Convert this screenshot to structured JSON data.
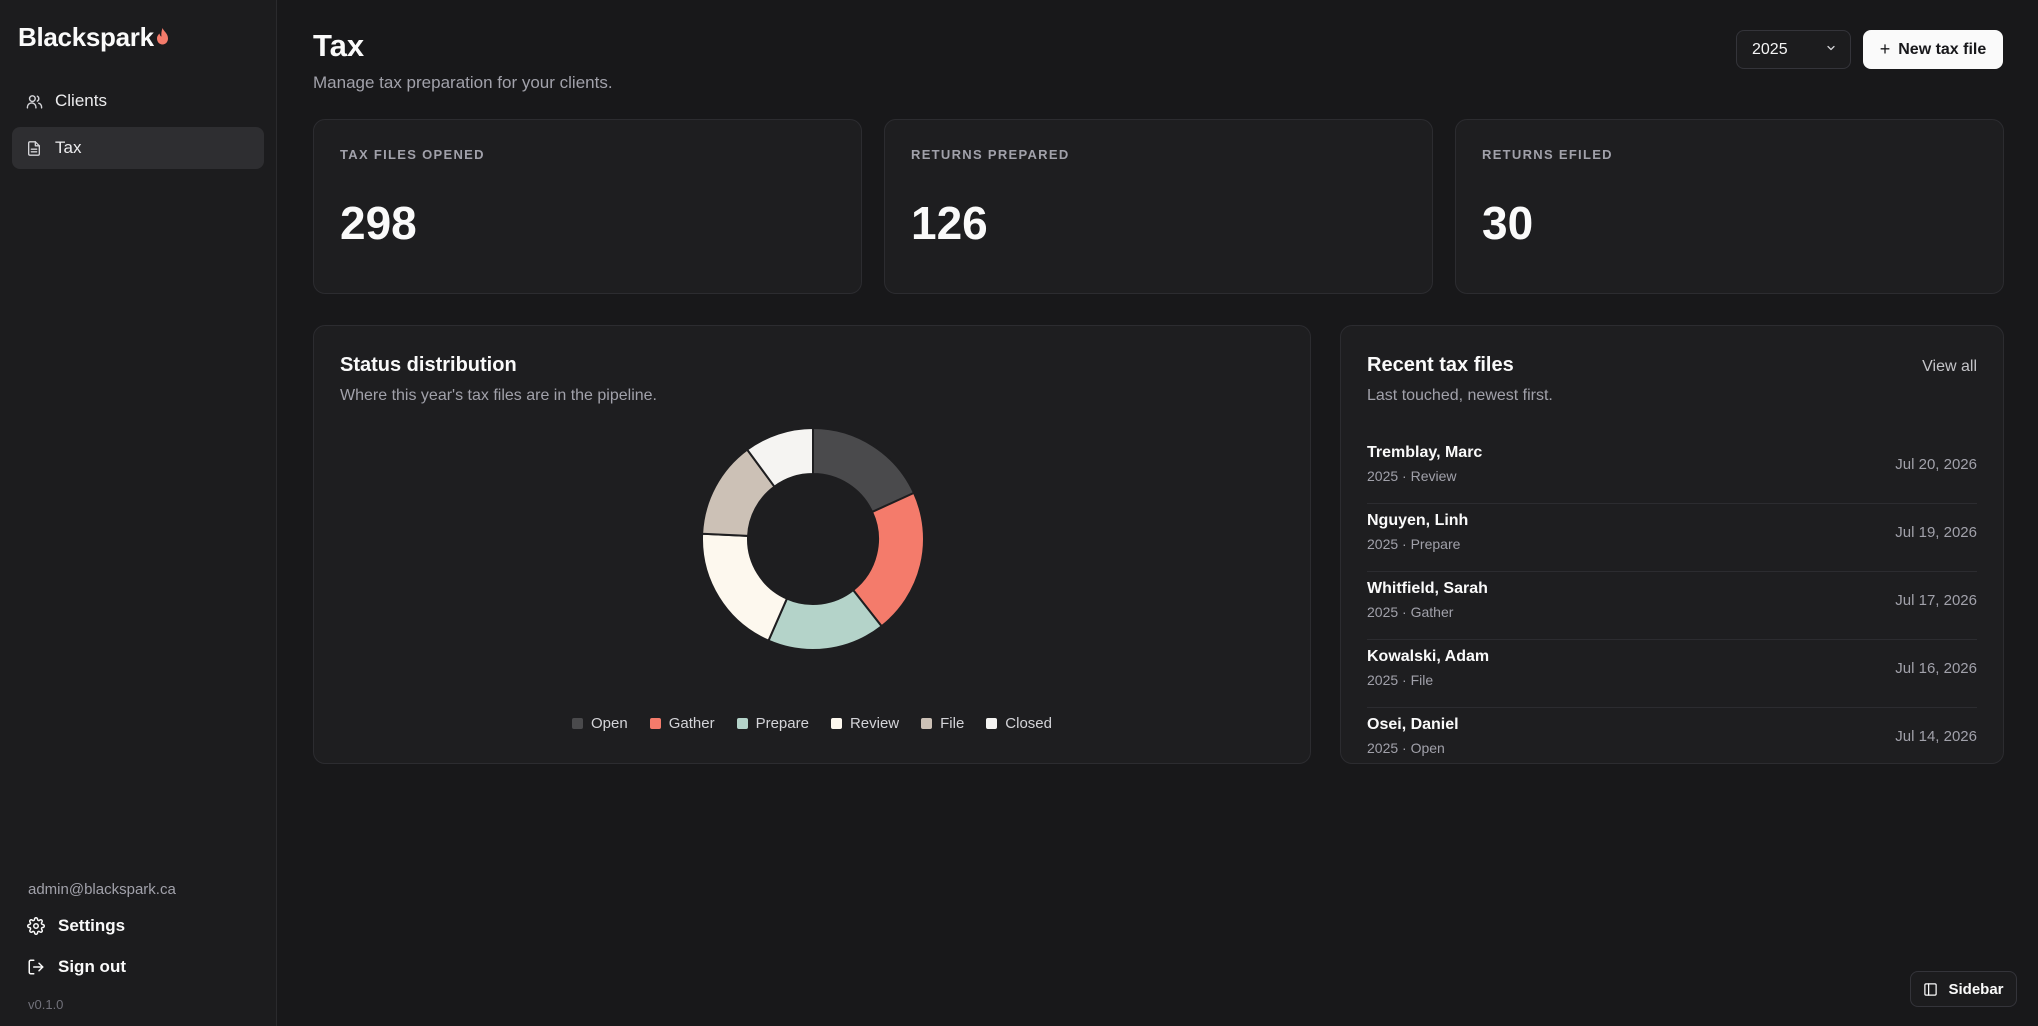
{
  "app": {
    "brand": "Blackspark"
  },
  "sidebar": {
    "items": [
      {
        "label": "Clients",
        "icon": "users-icon"
      },
      {
        "label": "Tax",
        "icon": "file-icon",
        "active": true
      }
    ],
    "user_email": "admin@blackspark.ca",
    "settings_label": "Settings",
    "signout_label": "Sign out",
    "version": "v0.1.0"
  },
  "header": {
    "title": "Tax",
    "subtitle": "Manage tax preparation for your clients.",
    "year_selected": "2025",
    "new_button_label": "New tax file"
  },
  "stats": [
    {
      "label": "TAX FILES OPENED",
      "value": "298"
    },
    {
      "label": "RETURNS PREPARED",
      "value": "126"
    },
    {
      "label": "RETURNS EFILED",
      "value": "30"
    }
  ],
  "status_panel": {
    "title": "Status distribution",
    "subtitle": "Where this year's tax files are in the pipeline."
  },
  "chart_data": {
    "type": "pie",
    "donut": true,
    "legend_position": "bottom",
    "series": [
      {
        "name": "Open",
        "value": 18,
        "color": "#4a4a4c"
      },
      {
        "name": "Gather",
        "value": 21,
        "color": "#f47b6b"
      },
      {
        "name": "Prepare",
        "value": 17,
        "color": "#b4d3c9"
      },
      {
        "name": "Review",
        "value": 19,
        "color": "#fdf8ee"
      },
      {
        "name": "File",
        "value": 14,
        "color": "#ccc1b6"
      },
      {
        "name": "Closed",
        "value": 10,
        "color": "#f5f4f2"
      }
    ]
  },
  "recent_panel": {
    "title": "Recent tax files",
    "subtitle": "Last touched, newest first.",
    "view_all_label": "View all",
    "items": [
      {
        "name": "Tremblay, Marc",
        "meta": "2025 · Review",
        "date": "Jul 20, 2026"
      },
      {
        "name": "Nguyen, Linh",
        "meta": "2025 · Prepare",
        "date": "Jul 19, 2026"
      },
      {
        "name": "Whitfield, Sarah",
        "meta": "2025 · Gather",
        "date": "Jul 17, 2026"
      },
      {
        "name": "Kowalski, Adam",
        "meta": "2025 · File",
        "date": "Jul 16, 2026"
      },
      {
        "name": "Osei, Daniel",
        "meta": "2025 · Open",
        "date": "Jul 14, 2026"
      }
    ]
  },
  "footer": {
    "sidebar_toggle_label": "Sidebar"
  },
  "colors": {
    "accent_flame": "#f47b6b",
    "background": "#18181a",
    "surface": "#1e1e20"
  }
}
